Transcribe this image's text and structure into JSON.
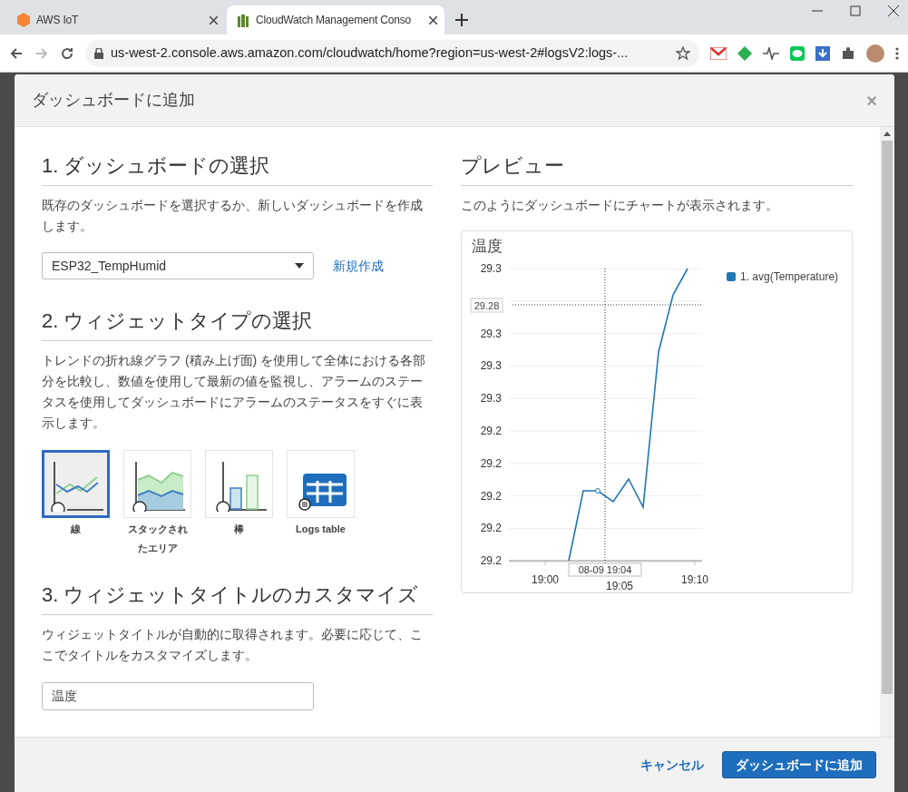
{
  "browser": {
    "tabs": [
      {
        "title": "AWS IoT",
        "selected": false,
        "kind": "iot"
      },
      {
        "title": "CloudWatch Management Conso",
        "selected": true,
        "kind": "cloudwatch"
      }
    ],
    "url": "us-west-2.console.aws.amazon.com/cloudwatch/home?region=us-west-2#logsV2:logs-..."
  },
  "dialog": {
    "title": "ダッシュボードに追加",
    "close": "×",
    "section1": {
      "heading": "1. ダッシュボードの選択",
      "description": "既存のダッシュボードを選択するか、新しいダッシュボードを作成します。",
      "dashboard": "ESP32_TempHumid",
      "create_link": "新規作成"
    },
    "section2": {
      "heading": "2. ウィジェットタイプの選択",
      "description": "トレンドの折れ線グラフ (積み上げ面) を使用して全体における各部分を比較し、数値を使用して最新の値を監視し、アラームのステータスを使用してダッシュボードにアラームのステータスをすぐに表示します。",
      "widget_types": [
        {
          "label": "線",
          "kind": "line",
          "selected": true
        },
        {
          "label": "スタックされたエリア",
          "kind": "area",
          "selected": false
        },
        {
          "label": "棒",
          "kind": "bar",
          "selected": false
        },
        {
          "label": "Logs table",
          "kind": "table",
          "selected": false
        }
      ]
    },
    "section3": {
      "heading": "3. ウィジェットタイトルのカスタマイズ",
      "description": "ウィジェットタイトルが自動的に取得されます。必要に応じて、ここでタイトルをカスタマイズします。",
      "title_value": "温度"
    },
    "preview": {
      "heading": "プレビュー",
      "description": "このようにダッシュボードにチャートが表示されます。",
      "chart": {
        "title": "温度",
        "y_labels": [
          "29.3",
          "29.3",
          "29.3",
          "29.3",
          "29.2",
          "29.2",
          "29.2",
          "29.2",
          "29.2"
        ],
        "crosshair_value": "29.28",
        "x_labels": [
          "19:00",
          "19:05",
          "19:10"
        ],
        "hover_time": "08-09 19:04",
        "legend": [
          {
            "name": "1. avg(Temperature)",
            "color": "#1f77b4"
          }
        ]
      }
    },
    "buttons": {
      "cancel": "キャンセル",
      "confirm": "ダッシュボードに追加"
    }
  }
}
